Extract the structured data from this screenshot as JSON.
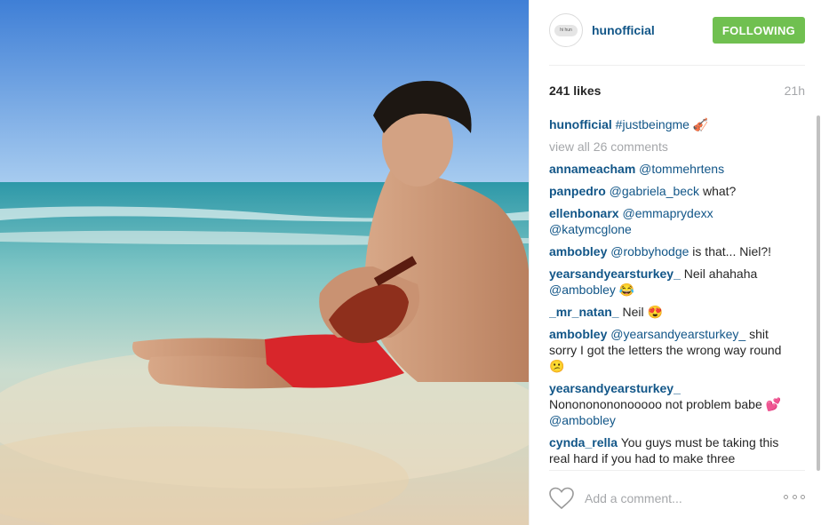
{
  "post": {
    "username": "hunofficial",
    "avatar_text": "hi hun",
    "follow_label": "FOLLOWING",
    "likes": "241 likes",
    "time": "21h",
    "caption_tag": "#justbeingme",
    "caption_emoji": "🎻",
    "view_all": "view all 26 comments",
    "add_comment_placeholder": "Add a comment...",
    "photo_alt": "Man sitting in shallow sea water playing ukulele"
  },
  "comments": [
    {
      "user": "annameacham",
      "mention": "@tommehrtens",
      "text": "",
      "emoji": ""
    },
    {
      "user": "panpedro",
      "mention": "@gabriela_beck",
      "text": " what?",
      "emoji": ""
    },
    {
      "user": "ellenbonarx",
      "mention": "@emmaprydexx @katymcglone",
      "text": "",
      "emoji": ""
    },
    {
      "user": "ambobley",
      "mention": "@robbyhodge",
      "text": " is that... Niel?!",
      "emoji": ""
    },
    {
      "user": "yearsandyearsturkey_",
      "mention": "",
      "text": " Neil ahahaha ",
      "mention2": "@ambobley",
      "emoji": "😂"
    },
    {
      "user": "_mr_natan_",
      "mention": "",
      "text": " Neil ",
      "emoji": "😍"
    },
    {
      "user": "ambobley",
      "mention": "@yearsandyearsturkey_",
      "text": " shit sorry I got the letters the wrong way round ",
      "emoji": "😕"
    },
    {
      "user": "yearsandyearsturkey_",
      "mention": "",
      "text": " Nonononononooooo not problem babe ",
      "emoji": "💕",
      "mention2": "@ambobley"
    },
    {
      "user": "cynda_rella",
      "mention": "",
      "text": " You guys must be taking this real hard if you had to make three consecutive posts about him tho...was it",
      "emoji": ""
    }
  ]
}
